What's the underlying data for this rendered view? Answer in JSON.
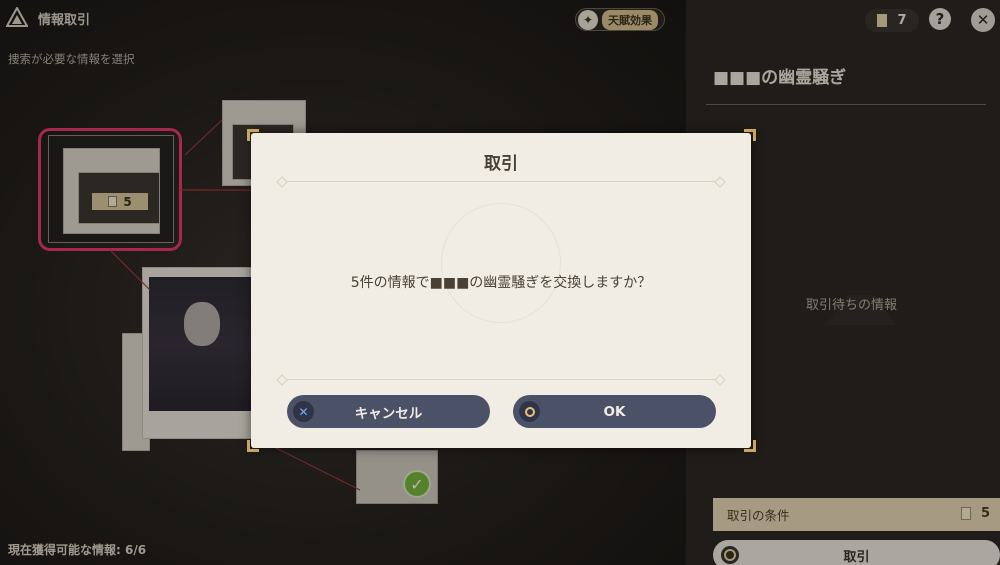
{
  "header": {
    "title": "情報取引",
    "instruction": "捜索が必要な情報を選択",
    "talent_label": "天賦効果",
    "doc_count": "7",
    "help_glyph": "?",
    "close_glyph": "✕"
  },
  "board": {
    "selected_cost": "5",
    "available_info": "現在獲得可能な情報: 6/6"
  },
  "right_panel": {
    "title": "■■■の幽霊騒ぎ",
    "pending": "取引待ちの情報",
    "condition_label": "取引の条件",
    "condition_count": "5",
    "trade_button": "取引"
  },
  "modal": {
    "title": "取引",
    "message": "5件の情報で■■■の幽霊騒ぎを交換しますか？",
    "cancel_label": "キャンセル",
    "ok_label": "OK",
    "cancel_glyph": "✕"
  },
  "colors": {
    "highlight": "#e5386c",
    "button": "#4b5268",
    "modal_bg": "#f1ede4",
    "accent_gold": "#caa560"
  }
}
